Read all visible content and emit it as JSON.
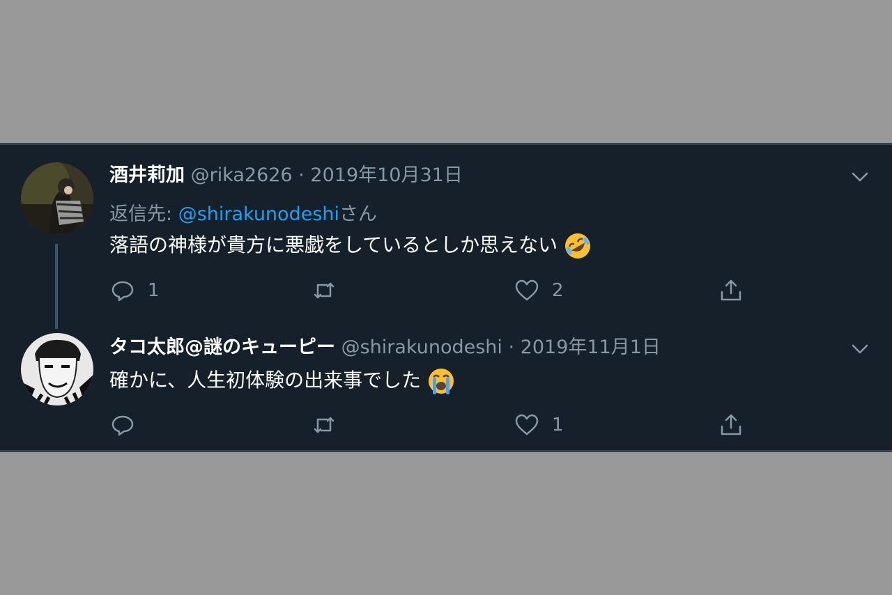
{
  "tweets": [
    {
      "name": "酒井莉加",
      "handle": "@rika2626",
      "sep": "·",
      "date": "2019年10月31日",
      "reply_prefix": "返信先: ",
      "reply_handle": "@shirakunodeshi",
      "reply_suffix": "さん",
      "text": "落語の神様が貴方に悪戯をしているとしか思えない",
      "emoji": "rolling-on-floor-laughing",
      "replies": "1",
      "likes": "2"
    },
    {
      "name": "タコ太郎@謎のキューピー",
      "handle": "@shirakunodeshi",
      "sep": "·",
      "date": "2019年11月1日",
      "text": "確かに、人生初体験の出来事でした",
      "emoji": "loudly-crying-face",
      "replies": "",
      "likes": "1"
    }
  ],
  "colors": {
    "background": "#15202b",
    "text": "#ffffff",
    "muted": "#8899a6",
    "link": "#1da1f2"
  }
}
